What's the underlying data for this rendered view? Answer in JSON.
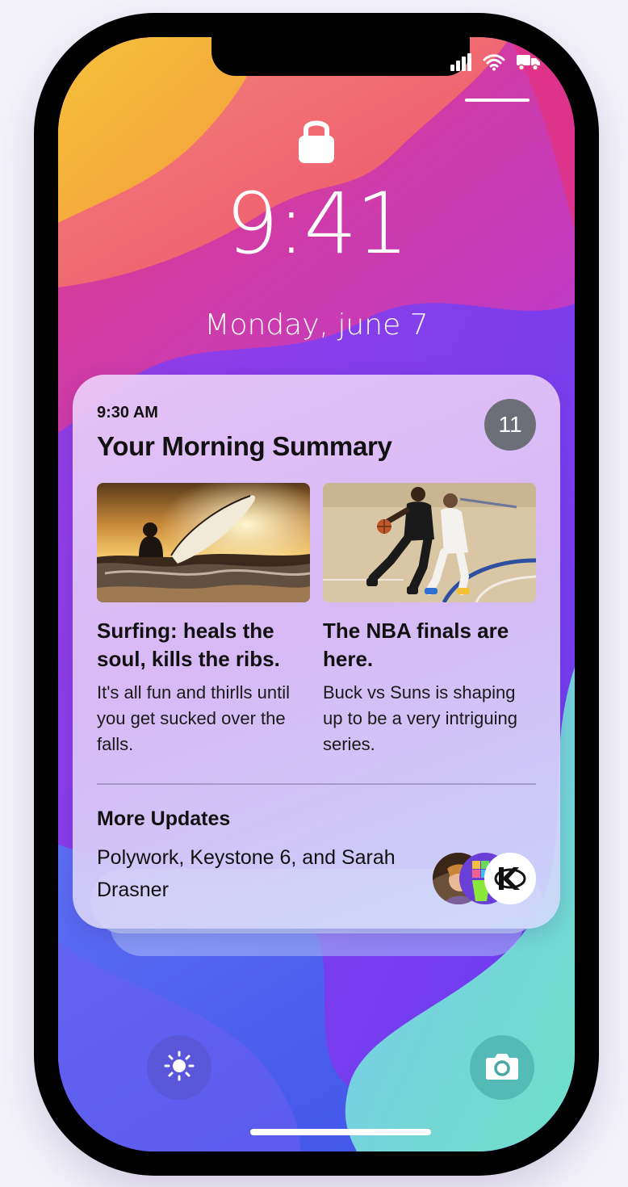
{
  "lock_screen": {
    "time": "9:41",
    "date": "Monday, june 7"
  },
  "status_bar": {
    "icons": [
      "signal-icon",
      "wifi-icon",
      "truck-icon"
    ]
  },
  "notification": {
    "time": "9:30 AM",
    "title": "Your Morning Summary",
    "count": "11",
    "stories": [
      {
        "title": "Surfing: heals the soul, kills the ribs.",
        "body": "It's all fun and thirlls until you get sucked over the falls.",
        "image": "surfer-sunset-image"
      },
      {
        "title": "The NBA finals are here.",
        "body": "Buck vs Suns is shaping up to be a very intriguing series.",
        "image": "basketball-players-image"
      }
    ],
    "more": {
      "title": "More Updates",
      "body": "Polywork, Keystone 6, and Sarah Drasner",
      "avatars": [
        "sarah-drasner-avatar",
        "polywork-avatar",
        "keystone-avatar"
      ]
    }
  },
  "quick_actions": {
    "left": "flashlight-icon",
    "right": "camera-icon"
  }
}
